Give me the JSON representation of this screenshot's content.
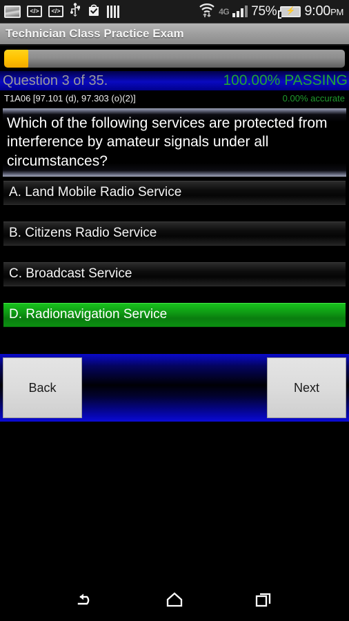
{
  "status_bar": {
    "icons_left": [
      {
        "name": "screenshot-icon",
        "label": ""
      },
      {
        "name": "code-icon-1",
        "label": "</>"
      },
      {
        "name": "code-icon-2",
        "label": "</>"
      },
      {
        "name": "usb-icon",
        "label": ""
      },
      {
        "name": "play-store-update-icon",
        "label": ""
      },
      {
        "name": "equalizer-icon",
        "label": ""
      }
    ],
    "wifi": "wifi-icon",
    "network_type": "4G",
    "signal": "signal-bars-icon",
    "battery_percent": "75%",
    "battery_state": "charging",
    "time": "9:00",
    "ampm": "PM"
  },
  "title_bar": {
    "title": "Technician Class Practice Exam"
  },
  "progress": {
    "percent": 7,
    "fill_color": "#ffc200",
    "track_color": "#8e8e8e"
  },
  "question_header": {
    "counter": "Question 3 of 35.",
    "passing": "100.00% PASSING",
    "question_id": "T1A06 [97.101 (d), 97.303 (o)(2)]",
    "accuracy": "0.00% accurate",
    "passing_color": "#22a733",
    "accuracy_color": "#1f9c2e",
    "header_bg_color": "#0a0ac0"
  },
  "question": {
    "text": "Which of the following services are protected from interference by amateur signals under all circumstances?"
  },
  "answers": [
    {
      "label": "A. Land Mobile Radio Service",
      "selected": false
    },
    {
      "label": "B. Citizens Radio Service",
      "selected": false
    },
    {
      "label": "C. Broadcast Service",
      "selected": false
    },
    {
      "label": "D. Radionavigation Service",
      "selected": true
    }
  ],
  "nav": {
    "back_label": "Back",
    "next_label": "Next",
    "bar_color": "#0606b4"
  },
  "system_nav": {
    "back": "back-arrow-icon",
    "home": "home-icon",
    "recents": "recent-apps-icon"
  }
}
